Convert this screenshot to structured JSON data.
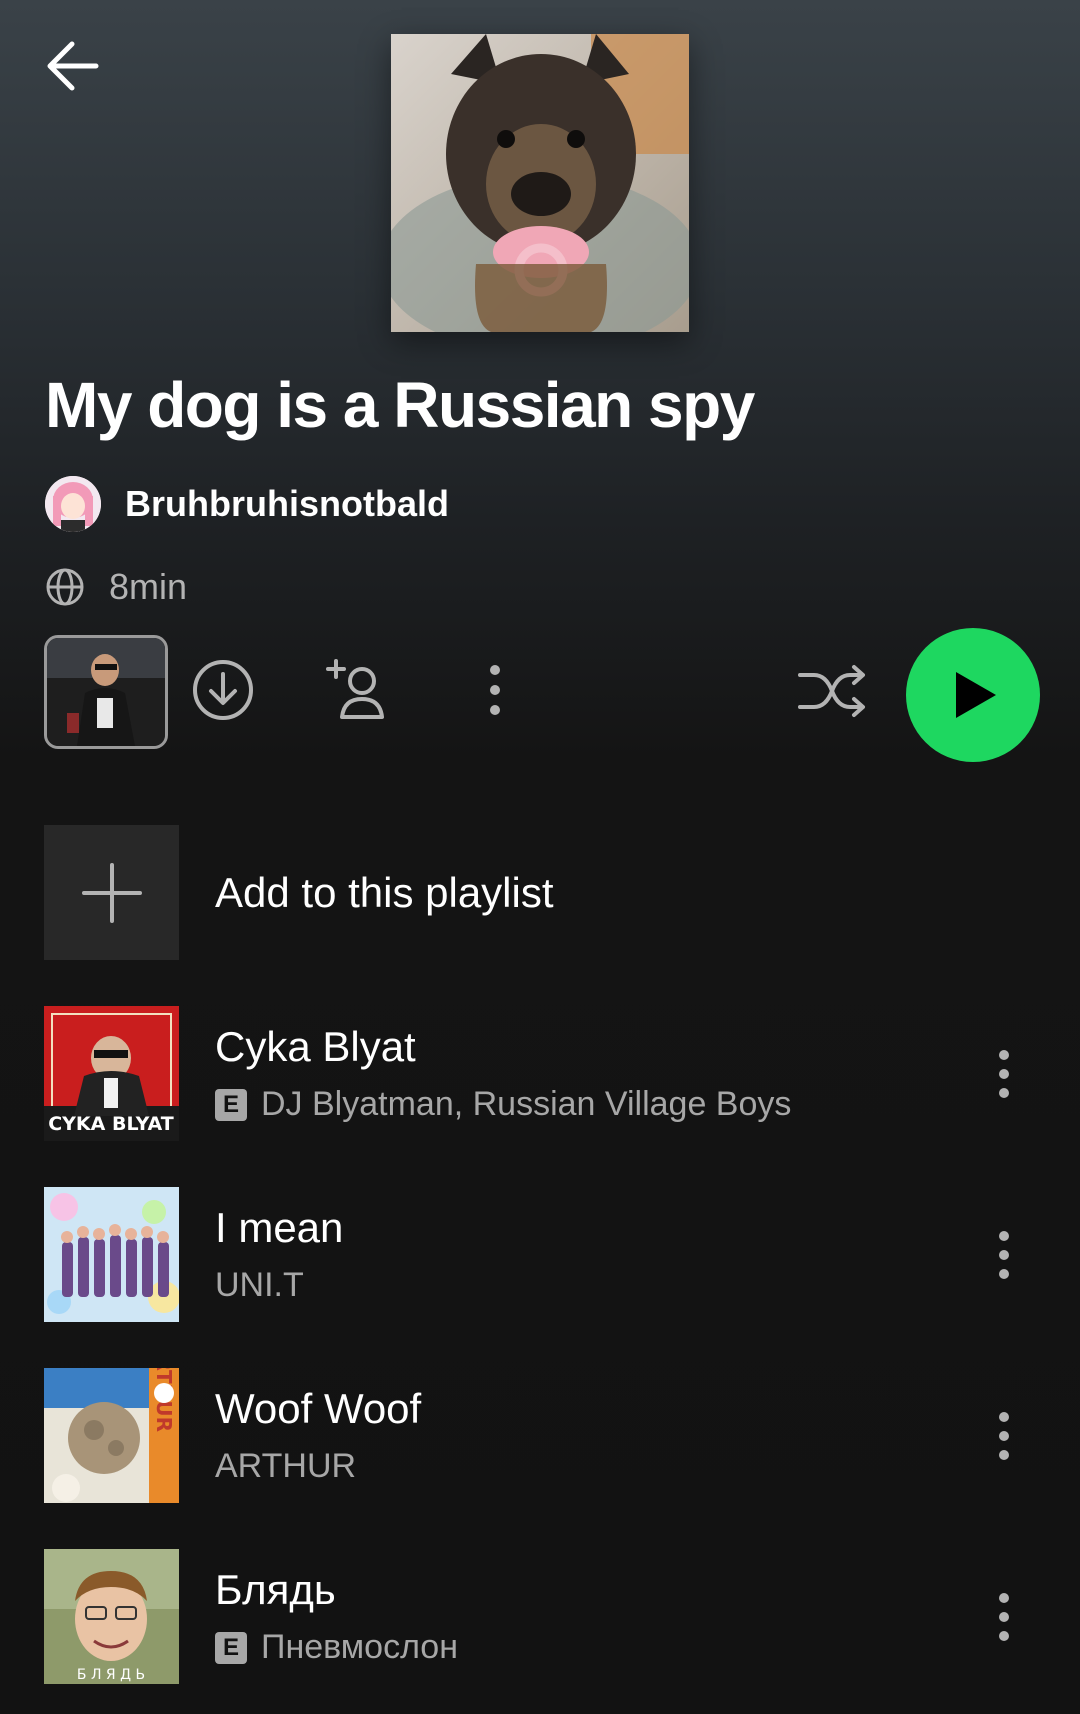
{
  "header": {
    "back_icon": "arrow-left-icon"
  },
  "playlist": {
    "cover_icon": "dog-with-pacifier-photo",
    "title": "My dog is a Russian spy",
    "owner": {
      "name": "Bruhbruhisnotbald",
      "avatar_icon": "anime-girl-avatar"
    },
    "visibility_icon": "globe-icon",
    "duration": "8min"
  },
  "actions": {
    "preview_icon": "playlist-preview-thumbnail",
    "download_icon": "download-icon",
    "add_user_icon": "add-user-icon",
    "more_icon": "more-vertical-icon",
    "shuffle_icon": "shuffle-icon",
    "play_icon": "play-icon",
    "accent": "#1ed760"
  },
  "add_row": {
    "label": "Add to this playlist",
    "icon": "plus-icon"
  },
  "tracks": [
    {
      "title": "Cyka Blyat",
      "artist": "DJ Blyatman, Russian Village Boys",
      "explicit": "E",
      "art_text": "CYKA BLYAT"
    },
    {
      "title": "I mean",
      "artist": "UNI.T",
      "explicit": null
    },
    {
      "title": "Woof Woof",
      "artist": "ARTHUR",
      "explicit": null,
      "art_text": "ARTHUR"
    },
    {
      "title": "Блядь",
      "artist": "Пневмослон",
      "explicit": "E",
      "art_text": "Б Л Я Д Ь"
    }
  ]
}
